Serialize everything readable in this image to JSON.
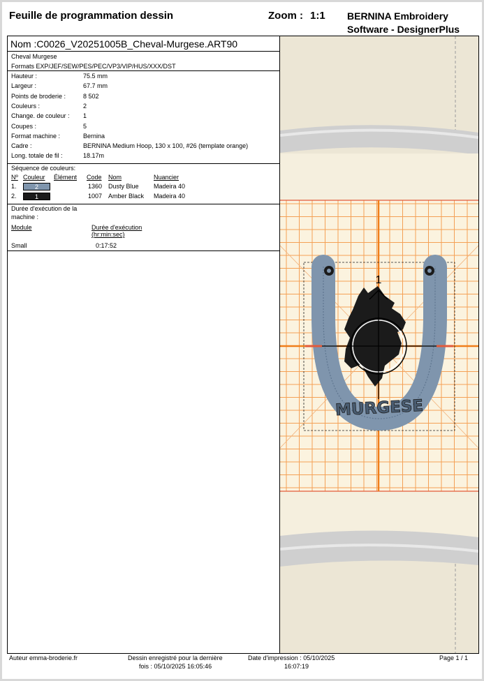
{
  "header": {
    "title": "Feuille de programmation dessin",
    "zoom_label": "Zoom :",
    "zoom_value": "1:1",
    "software_line1": "BERNINA Embroidery",
    "software_line2": "Software - DesignerPlus"
  },
  "design": {
    "name": "Nom  :C0026_V20251005B_Cheval-Murgese.ART90",
    "subtitle": "Cheval Murgese",
    "formats": "Formats EXP/JEF/SEW/PES/PEC/VP3/VIP/HUS/XXX/DST",
    "props": [
      {
        "label": "Hauteur :",
        "value": "75.5 mm"
      },
      {
        "label": "Largeur :",
        "value": "67.7 mm"
      },
      {
        "label": "Points de broderie :",
        "value": "8 502"
      },
      {
        "label": "Couleurs :",
        "value": "2"
      },
      {
        "label": "Change. de couleur :",
        "value": "1"
      },
      {
        "label": "Coupes :",
        "value": "5"
      },
      {
        "label": "Format machine :",
        "value": "Bernina"
      },
      {
        "label": "Cadre :",
        "value": "BERNINA Medium Hoop, 130 x 100, #26 (template orange)"
      },
      {
        "label": "Long. totale de fil :",
        "value": "18.17m"
      }
    ]
  },
  "colors": {
    "title": "Séquence de couleurs:",
    "headers": {
      "no": "Nº",
      "color": "Couleur",
      "element": "Élément",
      "code": "Code",
      "name": "Nom",
      "shade": "Nuancier"
    },
    "rows": [
      {
        "no": "1.",
        "swatch": "2",
        "swatch_color": "#7f95ad",
        "code": "1360",
        "name": "Dusty Blue",
        "shade": "Madeira 40"
      },
      {
        "no": "2.",
        "swatch": "1",
        "swatch_color": "#1b1b1b",
        "code": "1007",
        "name": "Amber Black",
        "shade": "Madeira 40"
      }
    ]
  },
  "duration": {
    "title1": "Durée d'exécution de la",
    "title2": "machine :",
    "col_module": "Module",
    "col_time1": "Durée d'exécution",
    "col_time2": "(hr:min:sec)",
    "module": "Small",
    "time": "0:17:52"
  },
  "preview": {
    "sequence_marker": "1",
    "design_text": "MURGESE"
  },
  "footer": {
    "author": "Auteur emma-broderie.fr",
    "saved1": "Dessin enregistré pour la dernière",
    "saved2": "fois : 05/10/2025 16:05:46",
    "printed1": "Date d'impression : 05/10/2025",
    "printed2": "16:07:19",
    "page": "Page 1 / 1"
  }
}
